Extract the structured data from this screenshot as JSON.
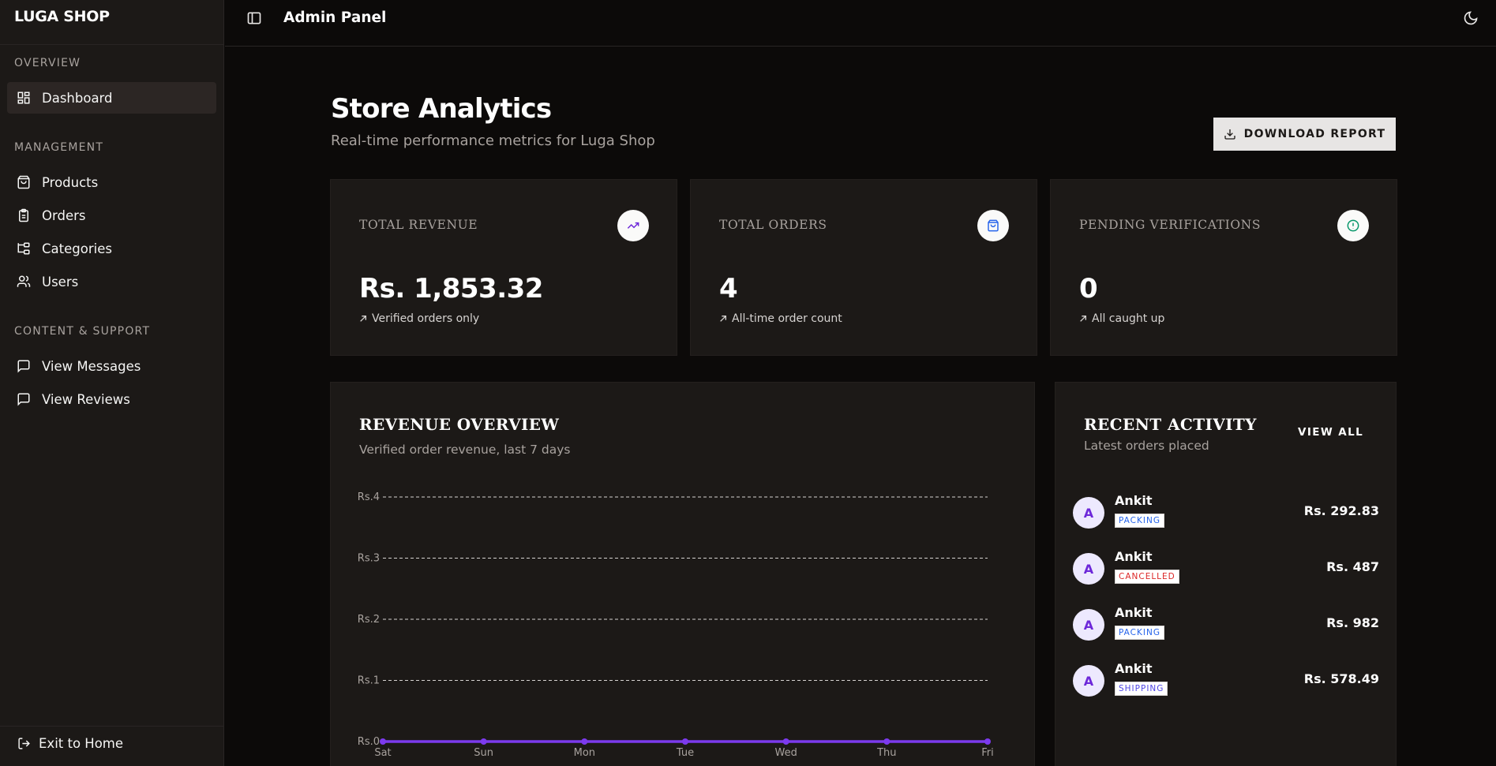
{
  "sidebar": {
    "brand": "LUGA SHOP",
    "groups": [
      {
        "title": "OVERVIEW"
      },
      {
        "title": "MANAGEMENT"
      },
      {
        "title": "CONTENT & SUPPORT"
      }
    ],
    "items": [
      {
        "label": "Dashboard",
        "icon": "dashboard-icon",
        "active": true
      },
      {
        "label": "Products",
        "icon": "shopping-bag-icon"
      },
      {
        "label": "Orders",
        "icon": "clipboard-icon"
      },
      {
        "label": "Categories",
        "icon": "folder-tree-icon"
      },
      {
        "label": "Users",
        "icon": "users-icon"
      },
      {
        "label": "View Messages",
        "icon": "message-icon"
      },
      {
        "label": "View Reviews",
        "icon": "message-icon"
      }
    ],
    "footer": {
      "label": "Exit to Home",
      "icon": "exit-icon"
    }
  },
  "topbar": {
    "title": "Admin Panel",
    "toggle_icon": "sidebar-toggle-icon",
    "theme_icon": "moon-icon"
  },
  "header": {
    "title": "Store Analytics",
    "subtitle": "Real-time performance metrics for Luga Shop",
    "download_label": "DOWNLOAD REPORT"
  },
  "stats": [
    {
      "label": "TOTAL REVENUE",
      "value": "Rs. 1,853.32",
      "note": "Verified orders only",
      "icon": "trending-up-icon",
      "icon_color": "#6d28d9"
    },
    {
      "label": "TOTAL ORDERS",
      "value": "4",
      "note": "All-time order count",
      "icon": "shopping-bag-icon",
      "icon_color": "#2563eb"
    },
    {
      "label": "PENDING VERIFICATIONS",
      "value": "0",
      "note": "All caught up",
      "icon": "alert-circle-icon",
      "icon_color": "#059669"
    }
  ],
  "revenue": {
    "title": "REVENUE OVERVIEW",
    "subtitle": "Verified order revenue, last 7 days"
  },
  "chart_data": {
    "type": "line",
    "categories": [
      "Sat",
      "Sun",
      "Mon",
      "Tue",
      "Wed",
      "Thu",
      "Fri"
    ],
    "values": [
      0,
      0,
      0,
      0,
      0,
      0,
      0
    ],
    "ylim": [
      0,
      4
    ],
    "yticks": [
      "Rs.0",
      "Rs.1",
      "Rs.2",
      "Rs.3",
      "Rs.4"
    ],
    "line_color": "#7c3aed",
    "grid": true
  },
  "activity": {
    "title": "RECENT ACTIVITY",
    "subtitle": "Latest orders placed",
    "view_all": "VIEW ALL",
    "items": [
      {
        "initial": "A",
        "name": "Ankit",
        "status": "PACKING",
        "status_color": "#2563eb",
        "amount": "Rs. 292.83"
      },
      {
        "initial": "A",
        "name": "Ankit",
        "status": "CANCELLED",
        "status_color": "#dc2626",
        "amount": "Rs. 487"
      },
      {
        "initial": "A",
        "name": "Ankit",
        "status": "PACKING",
        "status_color": "#2563eb",
        "amount": "Rs. 982"
      },
      {
        "initial": "A",
        "name": "Ankit",
        "status": "SHIPPING",
        "status_color": "#4f46e5",
        "amount": "Rs. 578.49"
      }
    ]
  }
}
